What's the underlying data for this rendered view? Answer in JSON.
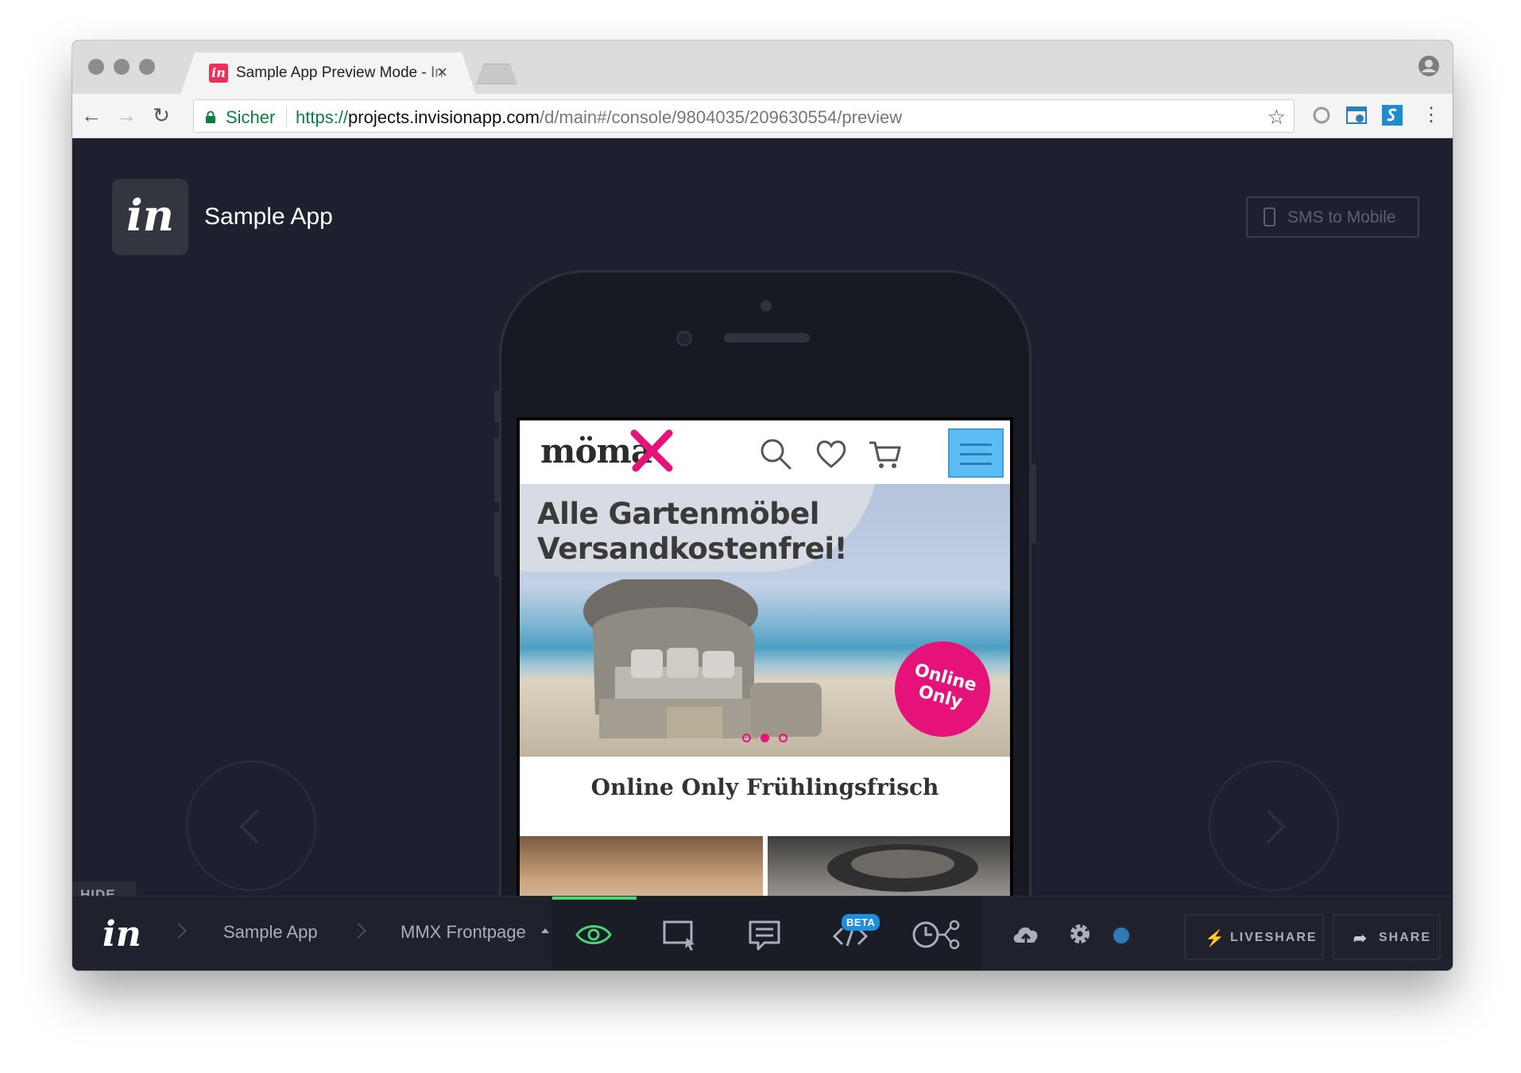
{
  "browser": {
    "tab_title": "Sample App Preview Mode - In",
    "tab_favicon": "in",
    "secure_label": "Sicher",
    "url_scheme": "https://",
    "url_host": "projects.invisionapp.com",
    "url_path": "/d/main#/console/9804035/209630554/preview"
  },
  "app": {
    "logo_text": "in",
    "project_name": "Sample App",
    "sms_button": "SMS to Mobile",
    "hide_label": "HIDE"
  },
  "prototype": {
    "brand": "möma",
    "hero_title_line1": "Alle Gartenmöbel",
    "hero_title_line2": "Versandkostenfrei!",
    "badge_line1": "Online",
    "badge_line2": "Only",
    "section_title": "Online Only Frühlingsfrisch",
    "brand_color": "#e6127a",
    "menu_color": "#5bbdf3"
  },
  "bottombar": {
    "logo_text": "in",
    "crumb_project": "Sample App",
    "crumb_screen": "MMX Frontpage",
    "beta_label": "BETA",
    "liveshare_label": "LIVESHARE",
    "share_label": "SHARE",
    "active_tool": "preview",
    "accent_color": "#4cd37a"
  }
}
